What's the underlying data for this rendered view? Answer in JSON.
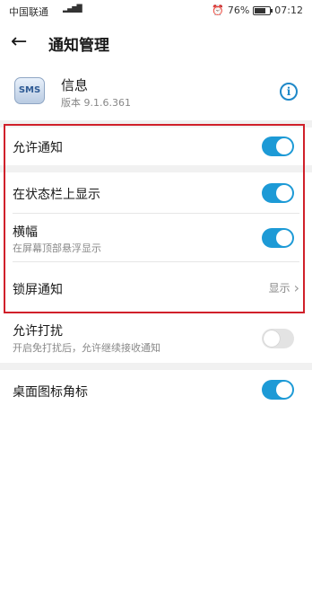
{
  "status_bar": {
    "carrier": "中国联通",
    "signal": "4G",
    "battery_percent": "76%",
    "battery_level": 0.76,
    "time": "07:12"
  },
  "header": {
    "title": "通知管理"
  },
  "app": {
    "name": "信息",
    "version": "版本 9.1.6.361",
    "icon_text": "SMS"
  },
  "settings": {
    "allow_notifications": {
      "label": "允许通知",
      "on": true
    },
    "status_bar_display": {
      "label": "在状态栏上显示",
      "on": true
    },
    "banner": {
      "label": "横幅",
      "sub": "在屏幕顶部悬浮显示",
      "on": true
    },
    "lock_screen": {
      "label": "锁屏通知",
      "value": "显示"
    },
    "dnd": {
      "label": "允许打扰",
      "sub": "开启免打扰后，允许继续接收通知",
      "on": false
    },
    "badge": {
      "label": "桌面图标角标",
      "on": true
    }
  },
  "colors": {
    "accent": "#1d9ad6",
    "highlight_border": "#d0202a"
  }
}
